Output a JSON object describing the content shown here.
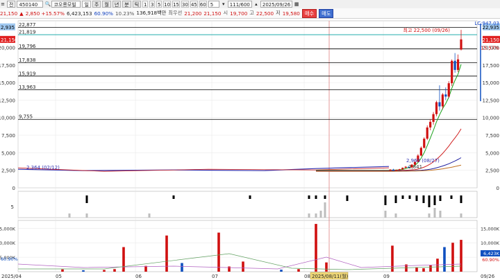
{
  "toolbar": {
    "icon_label": "전",
    "code": "450140",
    "name": "코오롱모빌",
    "periods": [
      "주",
      "월",
      "년",
      "분",
      "틱"
    ],
    "numbers": [
      "1",
      "3",
      "5",
      "10",
      "15",
      "30",
      "45",
      "60"
    ],
    "count_value": "5",
    "page_counter": "111/600",
    "date": "2025/09/26"
  },
  "info": {
    "price": "21,150",
    "change": "2,850 +15.57%",
    "volume": "6,423,153",
    "turnover": "60.90%",
    "ratio": "10.23%",
    "amount": "136,918백만",
    "pref_label": "최우선",
    "ask": "21,200",
    "bid": "21,150",
    "open_label": "시",
    "open": "19,700",
    "high_label": "고",
    "high": "22,500",
    "low_label": "저",
    "low": "19,580",
    "buy_label": "매수",
    "sell_label": "매도"
  },
  "colors": {
    "up": "#d01010",
    "down": "#1050c0",
    "ma5": "#18a018",
    "ma20": "#d02020",
    "ma60": "#2020a0",
    "ma120": "#c07020"
  },
  "price_chart": {
    "ymin": 0,
    "ymax": 23800,
    "yticks": [
      0,
      2500,
      5000,
      7500,
      10000,
      12500,
      15000,
      17500,
      20000
    ],
    "ytick_labels": [
      "0",
      "2,500",
      "5,000",
      "7,500",
      "10,000",
      "12,500",
      "15,000",
      "17,500",
      "20,000"
    ],
    "hlines": [
      {
        "value": 22877,
        "label": "22,877",
        "color": "#000"
      },
      {
        "value": 21819,
        "label": "21,819",
        "color": "#00a0a0"
      },
      {
        "value": 19796,
        "label": "19,796",
        "color": "#000"
      },
      {
        "value": 17838,
        "label": "17,838",
        "color": "#000"
      },
      {
        "value": 15919,
        "label": "15,919",
        "color": "#000"
      },
      {
        "value": 13963,
        "label": "13,963",
        "color": "#000"
      },
      {
        "value": 9755,
        "label": "9,755",
        "color": "#000"
      }
    ],
    "right_tags": [
      {
        "value": 22935,
        "label": "22,935",
        "bg": "#a0c8f0",
        "fg": "#000"
      },
      {
        "value": 21150,
        "label": "21,150",
        "bg": "#e02020",
        "fg": "#fff"
      }
    ],
    "left_tags": [
      {
        "value": 22935,
        "label": "2,935",
        "bg": "#a0c8f0",
        "fg": "#000"
      },
      {
        "value": 21150,
        "label": "21,150",
        "bg": "#e02020",
        "fg": "#fff"
      }
    ],
    "right_text": [
      {
        "value": 23500,
        "label": "LC:947.03",
        "color": "#1040c0"
      },
      {
        "value": 20000,
        "label": "15.57%",
        "color": "#d01010"
      }
    ],
    "annotation": {
      "label": "최고 22,500 (09/26)",
      "value": 22500
    },
    "left_annotation": "2,364 (02/12)",
    "low_annotations": [
      "2,960 (08/27)",
      "2,841"
    ],
    "candles": [
      {
        "o": 2500,
        "h": 2650,
        "l": 2400,
        "c": 2600
      },
      {
        "o": 2600,
        "h": 2700,
        "l": 2450,
        "c": 2480
      },
      {
        "o": 2480,
        "h": 2600,
        "l": 2380,
        "c": 2550
      },
      {
        "o": 2550,
        "h": 2700,
        "l": 2500,
        "c": 2650
      },
      {
        "o": 2650,
        "h": 2900,
        "l": 2600,
        "c": 2850
      },
      {
        "o": 2850,
        "h": 3100,
        "l": 2800,
        "c": 3000
      },
      {
        "o": 3000,
        "h": 3050,
        "l": 2850,
        "c": 2900
      },
      {
        "o": 2900,
        "h": 3400,
        "l": 2880,
        "c": 3300
      },
      {
        "o": 3300,
        "h": 3800,
        "l": 3200,
        "c": 3700
      },
      {
        "o": 3700,
        "h": 4800,
        "l": 3650,
        "c": 4600
      },
      {
        "o": 4600,
        "h": 5900,
        "l": 4500,
        "c": 5700
      },
      {
        "o": 5700,
        "h": 7200,
        "l": 5600,
        "c": 7000
      },
      {
        "o": 7000,
        "h": 8900,
        "l": 6800,
        "c": 8600
      },
      {
        "o": 8600,
        "h": 9800,
        "l": 8200,
        "c": 9400
      },
      {
        "o": 9400,
        "h": 10800,
        "l": 9000,
        "c": 10500
      },
      {
        "o": 10500,
        "h": 12400,
        "l": 10200,
        "c": 12200
      },
      {
        "o": 12200,
        "h": 14600,
        "l": 11000,
        "c": 11600
      },
      {
        "o": 11600,
        "h": 13500,
        "l": 11200,
        "c": 13300
      },
      {
        "o": 13300,
        "h": 14300,
        "l": 12500,
        "c": 13000
      },
      {
        "o": 13000,
        "h": 15200,
        "l": 12800,
        "c": 14900
      },
      {
        "o": 14900,
        "h": 18300,
        "l": 14500,
        "c": 18100
      },
      {
        "o": 18100,
        "h": 19200,
        "l": 16400,
        "c": 16800
      },
      {
        "o": 16800,
        "h": 19000,
        "l": 16500,
        "c": 18300
      },
      {
        "o": 19700,
        "h": 22500,
        "l": 19580,
        "c": 21150
      }
    ],
    "flat_value": 2450,
    "ma": [
      {
        "name": "ma5",
        "values": [
          2500,
          2520,
          2540,
          2560,
          2620,
          2760,
          2880,
          3000,
          3200,
          3600,
          4200,
          5000,
          6000,
          7100,
          8200,
          9400,
          10400,
          11300,
          12000,
          12900,
          14200,
          15300,
          16200,
          17600
        ]
      },
      {
        "name": "ma20",
        "values": [
          2450,
          2460,
          2470,
          2480,
          2490,
          2510,
          2530,
          2560,
          2600,
          2680,
          2800,
          2950,
          3150,
          3400,
          3700,
          4050,
          4450,
          4900,
          5400,
          5950,
          6550,
          7100,
          7700,
          8400
        ]
      },
      {
        "name": "ma60",
        "values": [
          2400,
          2410,
          2410,
          2420,
          2420,
          2430,
          2440,
          2450,
          2460,
          2480,
          2500,
          2540,
          2590,
          2660,
          2750,
          2850,
          2970,
          3110,
          3260,
          3430,
          3620,
          3820,
          4050,
          4300
        ]
      },
      {
        "name": "ma120",
        "values": [
          2350,
          2350,
          2360,
          2360,
          2370,
          2370,
          2380,
          2390,
          2400,
          2410,
          2420,
          2440,
          2470,
          2500,
          2540,
          2590,
          2650,
          2710,
          2780,
          2860,
          2940,
          3030,
          3130,
          3230
        ]
      }
    ]
  },
  "indicator": {
    "label": "5",
    "bars": [
      0,
      -3,
      0,
      1,
      0,
      0,
      0,
      1,
      1,
      1,
      0,
      1,
      2,
      4,
      3,
      1,
      1,
      2,
      3,
      5,
      4,
      2,
      1,
      3
    ],
    "gray_bars": [
      1,
      1,
      1,
      0,
      0,
      0,
      0,
      0,
      1,
      1,
      2,
      5,
      0,
      2,
      1,
      0,
      0,
      0,
      0,
      1,
      3,
      2,
      0,
      1
    ]
  },
  "volume_chart": {
    "yticks": [
      5000,
      10000,
      15000
    ],
    "ytick_labels": [
      "5,000K",
      "10,000K",
      "15,000K"
    ],
    "right_tags": [
      {
        "label": "6,423K",
        "bg": "#1050c0",
        "fg": "#fff"
      },
      {
        "label": "60.90%",
        "bg": "#fff",
        "fg": "#d01010"
      }
    ],
    "left_label": "60.90%",
    "values": [
      800,
      500,
      600,
      900,
      8500,
      2000,
      12500,
      3000,
      13500,
      1800,
      3500,
      700,
      900,
      16500,
      3200,
      9000,
      2500,
      1500,
      1200,
      2200,
      4500,
      8500,
      10000,
      11000
    ],
    "up": [
      true,
      false,
      true,
      true,
      true,
      true,
      true,
      false,
      true,
      true,
      true,
      false,
      true,
      true,
      true,
      true,
      true,
      true,
      true,
      true,
      true,
      false,
      true,
      true
    ]
  },
  "x_axis": {
    "labels": [
      "2025/04",
      "05",
      "06",
      "07",
      "08",
      "09",
      "09/26"
    ],
    "highlight_label": "2025/08/11(월)"
  }
}
